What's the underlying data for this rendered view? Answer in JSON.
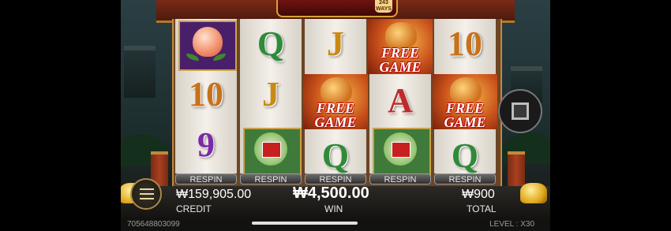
{
  "game": {
    "reels": [
      {
        "symbols": [
          "peach",
          "9",
          "10"
        ],
        "respin_label": "RESPIN"
      },
      {
        "symbols": [
          "Q",
          "J",
          "bok-choy"
        ],
        "respin_label": "RESPIN"
      },
      {
        "symbols": [
          "J",
          "FREE GAME",
          "Q"
        ],
        "respin_label": "RESPIN"
      },
      {
        "symbols": [
          "FREE GAME",
          "A",
          "bok-choy"
        ],
        "respin_label": "RESPIN"
      },
      {
        "symbols": [
          "10",
          "FREE GAME",
          "Q"
        ],
        "respin_label": "RESPIN"
      }
    ],
    "free_game": {
      "line1": "FREE",
      "line2": "GAME"
    },
    "letters": {
      "q": "Q",
      "j": "J",
      "ten": "10",
      "nine": "9",
      "a": "A"
    },
    "logo_ways": "243 WAYS"
  },
  "hud": {
    "credit_value": "₩159,905.00",
    "credit_label": "CREDIT",
    "win_value": "₩4,500.00",
    "win_label": "WIN",
    "total_value": "₩900",
    "total_label": "TOTAL"
  },
  "footer": {
    "session_id": "705648803099",
    "level_text": "LEVEL : X30"
  },
  "colors": {
    "accent_gold": "#d9a13a",
    "free_game_red": "#c01010",
    "q_green": "#2e8b3a"
  },
  "icons": {
    "menu": "hamburger-menu-icon",
    "stop": "stop-square-icon"
  }
}
